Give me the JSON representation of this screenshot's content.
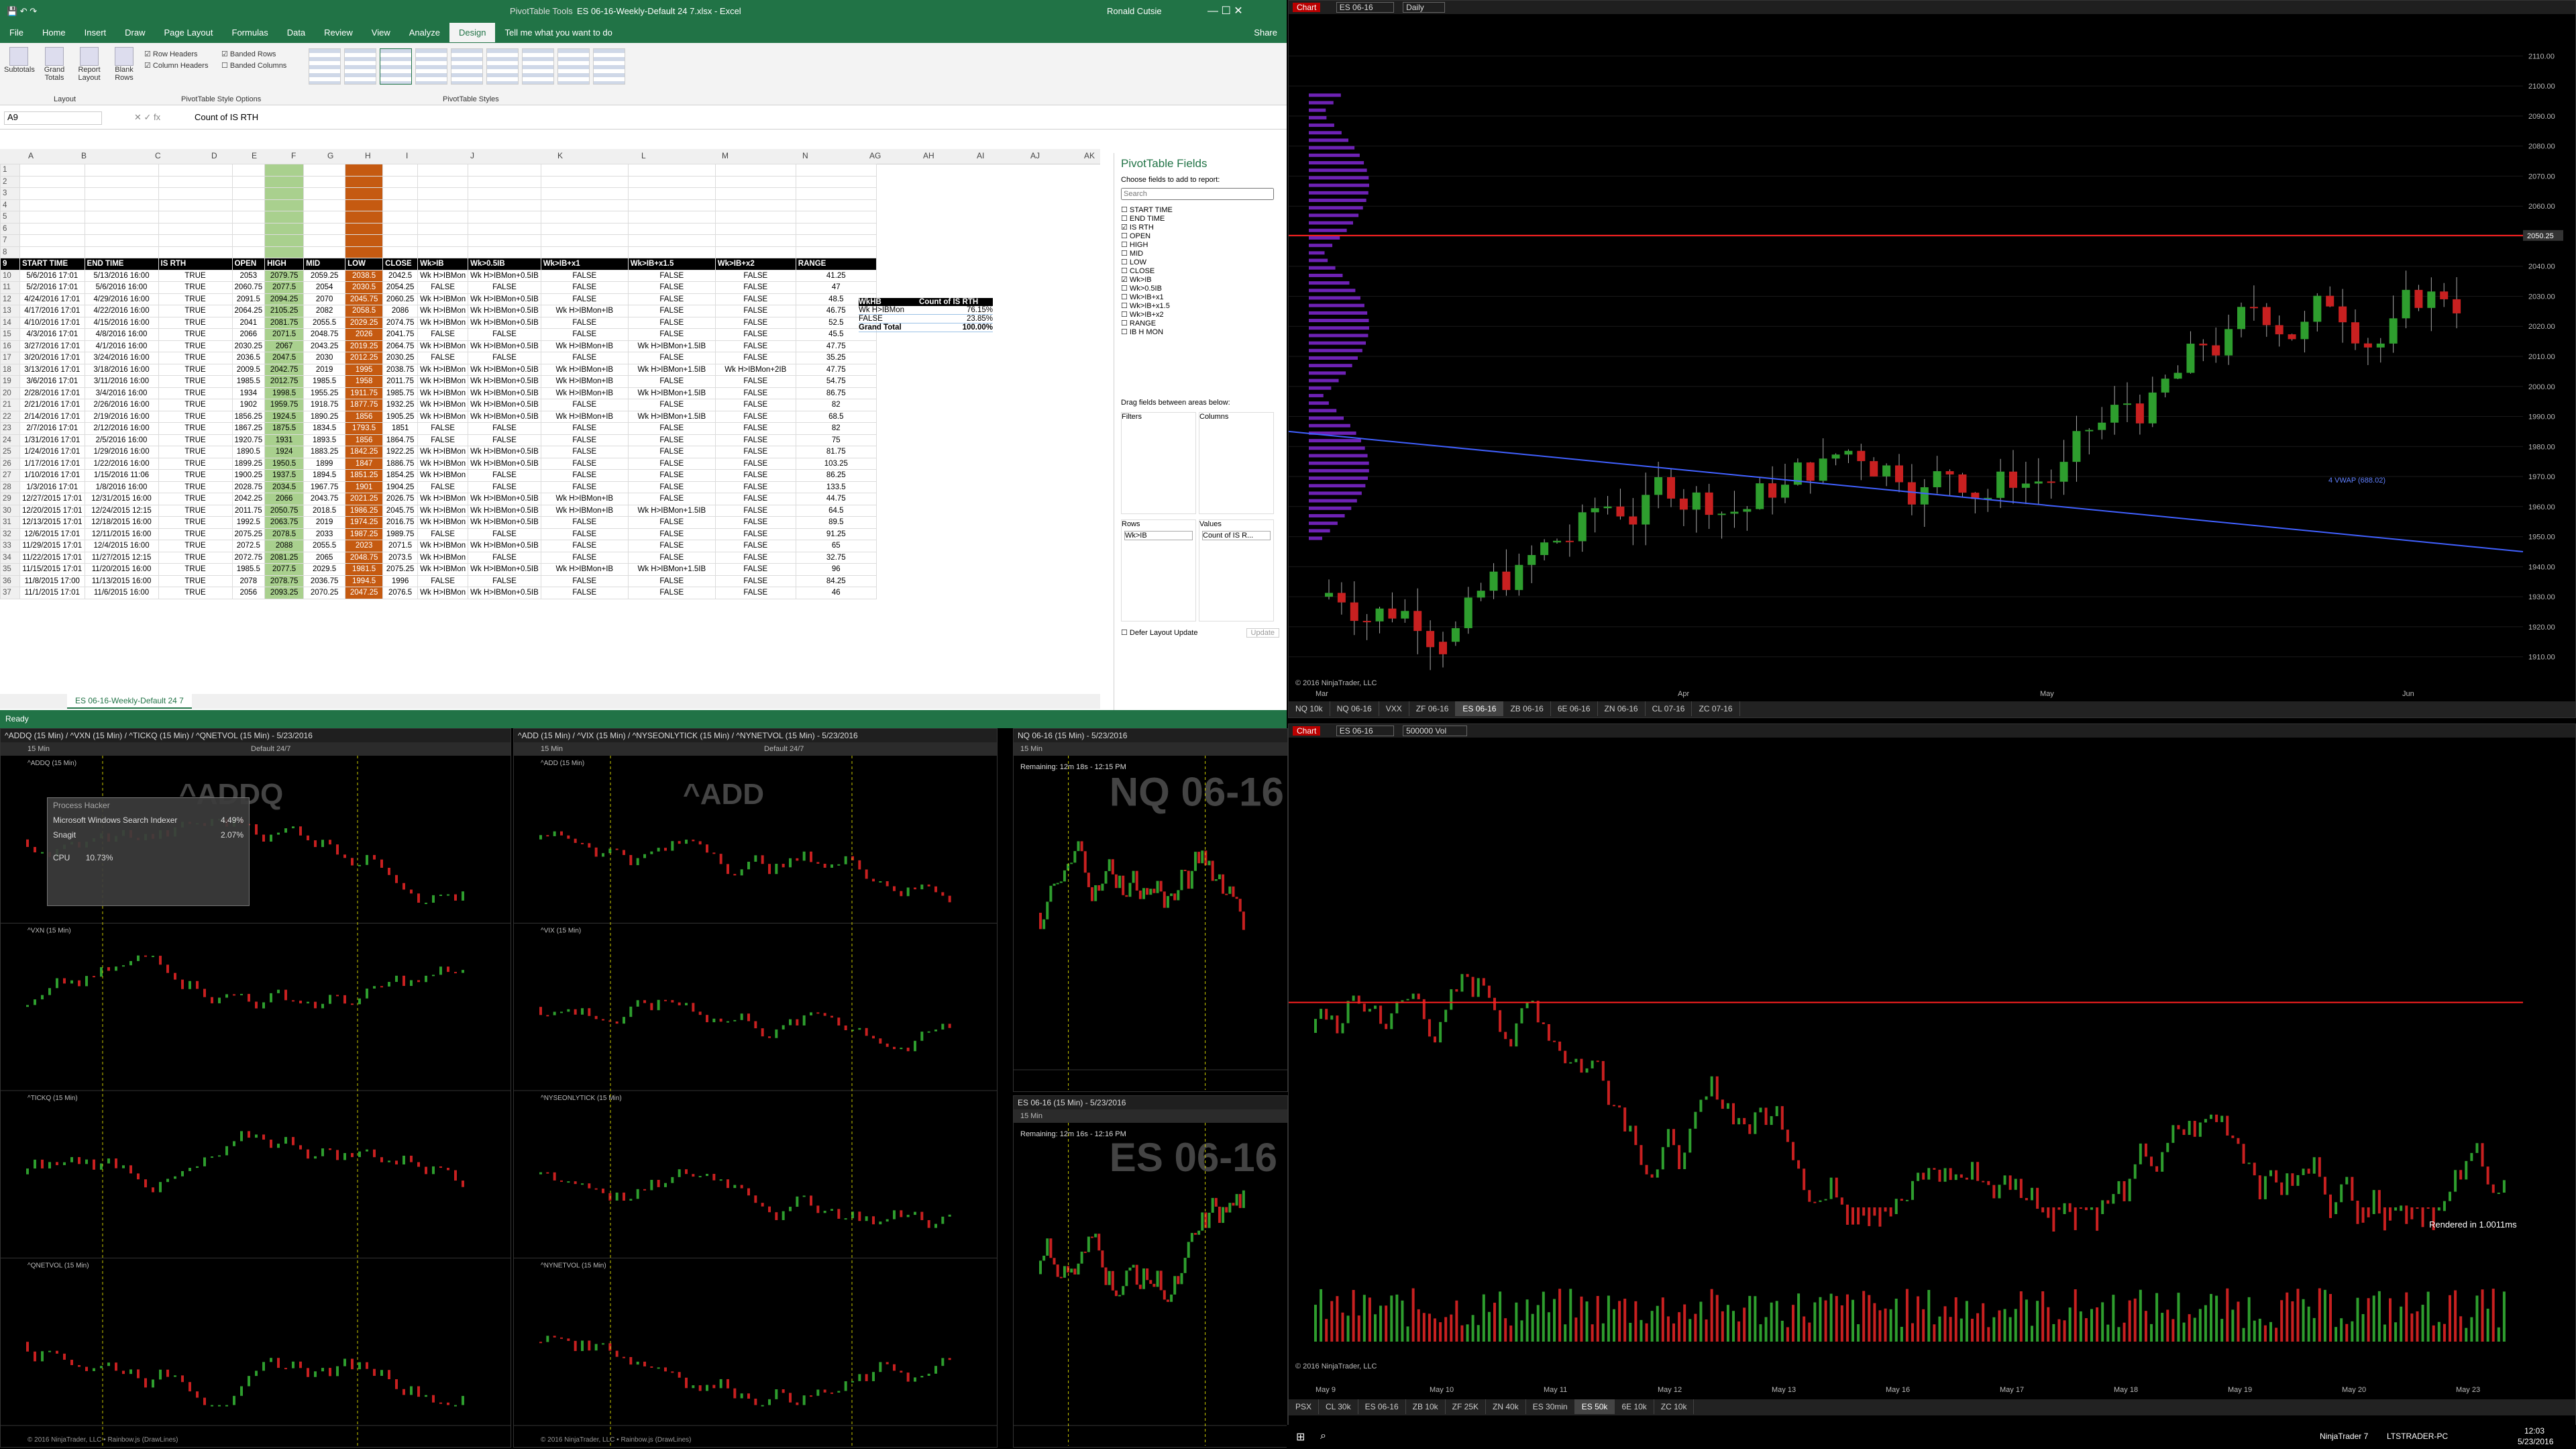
{
  "excel": {
    "title": "ES 06-16-Weekly-Default 24 7.xlsx - Excel",
    "context_tab": "PivotTable Tools",
    "user": "Ronald Cutsie",
    "tabs": [
      "File",
      "Home",
      "Insert",
      "Draw",
      "Page Layout",
      "Formulas",
      "Data",
      "Review",
      "View",
      "Analyze",
      "Design"
    ],
    "tell_me": "Tell me what you want to do",
    "share": "Share",
    "ribbon": {
      "layout": [
        "Subtotals",
        "Grand Totals",
        "Report Layout",
        "Blank Rows"
      ],
      "group_layout": "Layout",
      "options": [
        "Row Headers",
        "Banded Rows",
        "Column Headers",
        "Banded Columns"
      ],
      "group_options": "PivotTable Style Options",
      "group_styles": "PivotTable Styles"
    },
    "name_box": "A9",
    "formula": "Count of IS RTH",
    "columns": [
      "A",
      "B",
      "C",
      "D",
      "E",
      "F",
      "G",
      "H",
      "I",
      "J",
      "K",
      "L",
      "M",
      "N",
      "AG",
      "AH",
      "AI",
      "AJ",
      "AK"
    ],
    "header_row": [
      "START TIME",
      "END TIME",
      "IS RTH",
      "OPEN",
      "HIGH",
      "MID",
      "LOW",
      "CLOSE",
      "Wk>IB",
      "Wk>0.5IB",
      "Wk>IB+x1",
      "Wk>IB+x1.5",
      "Wk>IB+x2",
      "RANGE"
    ],
    "rows": [
      [
        "10",
        "5/6/2016 17:01",
        "5/13/2016 16:00",
        "TRUE",
        "2053",
        "2079.75",
        "2059.25",
        "2038.5",
        "2042.5",
        "Wk H>IBMon",
        "Wk H>IBMon+0.5IB",
        "FALSE",
        "FALSE",
        "FALSE",
        "41.25"
      ],
      [
        "11",
        "5/2/2016 17:01",
        "5/6/2016 16:00",
        "TRUE",
        "2060.75",
        "2077.5",
        "2054",
        "2030.5",
        "2054.25",
        "FALSE",
        "FALSE",
        "FALSE",
        "FALSE",
        "FALSE",
        "47"
      ],
      [
        "12",
        "4/24/2016 17:01",
        "4/29/2016 16:00",
        "TRUE",
        "2091.5",
        "2094.25",
        "2070",
        "2045.75",
        "2060.25",
        "Wk H>IBMon",
        "Wk H>IBMon+0.5IB",
        "FALSE",
        "FALSE",
        "FALSE",
        "48.5"
      ],
      [
        "13",
        "4/17/2016 17:01",
        "4/22/2016 16:00",
        "TRUE",
        "2064.25",
        "2105.25",
        "2082",
        "2058.5",
        "2086",
        "Wk H>IBMon",
        "Wk H>IBMon+0.5IB",
        "Wk H>IBMon+IB",
        "FALSE",
        "FALSE",
        "46.75"
      ],
      [
        "14",
        "4/10/2016 17:01",
        "4/15/2016 16:00",
        "TRUE",
        "2041",
        "2081.75",
        "2055.5",
        "2029.25",
        "2074.75",
        "Wk H>IBMon",
        "Wk H>IBMon+0.5IB",
        "FALSE",
        "FALSE",
        "FALSE",
        "52.5"
      ],
      [
        "15",
        "4/3/2016 17:01",
        "4/8/2016 16:00",
        "TRUE",
        "2066",
        "2071.5",
        "2048.75",
        "2026",
        "2041.75",
        "FALSE",
        "FALSE",
        "FALSE",
        "FALSE",
        "FALSE",
        "45.5"
      ],
      [
        "16",
        "3/27/2016 17:01",
        "4/1/2016 16:00",
        "TRUE",
        "2030.25",
        "2067",
        "2043.25",
        "2019.25",
        "2064.75",
        "Wk H>IBMon",
        "Wk H>IBMon+0.5IB",
        "Wk H>IBMon+IB",
        "Wk H>IBMon+1.5IB",
        "FALSE",
        "47.75"
      ],
      [
        "17",
        "3/20/2016 17:01",
        "3/24/2016 16:00",
        "TRUE",
        "2036.5",
        "2047.5",
        "2030",
        "2012.25",
        "2030.25",
        "FALSE",
        "FALSE",
        "FALSE",
        "FALSE",
        "FALSE",
        "35.25"
      ],
      [
        "18",
        "3/13/2016 17:01",
        "3/18/2016 16:00",
        "TRUE",
        "2009.5",
        "2042.75",
        "2019",
        "1995",
        "2038.75",
        "Wk H>IBMon",
        "Wk H>IBMon+0.5IB",
        "Wk H>IBMon+IB",
        "Wk H>IBMon+1.5IB",
        "Wk H>IBMon+2IB",
        "47.75"
      ],
      [
        "19",
        "3/6/2016 17:01",
        "3/11/2016 16:00",
        "TRUE",
        "1985.5",
        "2012.75",
        "1985.5",
        "1958",
        "2011.75",
        "Wk H>IBMon",
        "Wk H>IBMon+0.5IB",
        "Wk H>IBMon+IB",
        "FALSE",
        "FALSE",
        "54.75"
      ],
      [
        "20",
        "2/28/2016 17:01",
        "3/4/2016 16:00",
        "TRUE",
        "1934",
        "1998.5",
        "1955.25",
        "1911.75",
        "1985.75",
        "Wk H>IBMon",
        "Wk H>IBMon+0.5IB",
        "Wk H>IBMon+IB",
        "Wk H>IBMon+1.5IB",
        "FALSE",
        "86.75"
      ],
      [
        "21",
        "2/21/2016 17:01",
        "2/26/2016 16:00",
        "TRUE",
        "1902",
        "1959.75",
        "1918.75",
        "1877.75",
        "1932.25",
        "Wk H>IBMon",
        "Wk H>IBMon+0.5IB",
        "FALSE",
        "FALSE",
        "FALSE",
        "82"
      ],
      [
        "22",
        "2/14/2016 17:01",
        "2/19/2016 16:00",
        "TRUE",
        "1856.25",
        "1924.5",
        "1890.25",
        "1856",
        "1905.25",
        "Wk H>IBMon",
        "Wk H>IBMon+0.5IB",
        "Wk H>IBMon+IB",
        "Wk H>IBMon+1.5IB",
        "FALSE",
        "68.5"
      ],
      [
        "23",
        "2/7/2016 17:01",
        "2/12/2016 16:00",
        "TRUE",
        "1867.25",
        "1875.5",
        "1834.5",
        "1793.5",
        "1851",
        "FALSE",
        "FALSE",
        "FALSE",
        "FALSE",
        "FALSE",
        "82"
      ],
      [
        "24",
        "1/31/2016 17:01",
        "2/5/2016 16:00",
        "TRUE",
        "1920.75",
        "1931",
        "1893.5",
        "1856",
        "1864.75",
        "FALSE",
        "FALSE",
        "FALSE",
        "FALSE",
        "FALSE",
        "75"
      ],
      [
        "25",
        "1/24/2016 17:01",
        "1/29/2016 16:00",
        "TRUE",
        "1890.5",
        "1924",
        "1883.25",
        "1842.25",
        "1922.25",
        "Wk H>IBMon",
        "Wk H>IBMon+0.5IB",
        "FALSE",
        "FALSE",
        "FALSE",
        "81.75"
      ],
      [
        "26",
        "1/17/2016 17:01",
        "1/22/2016 16:00",
        "TRUE",
        "1899.25",
        "1950.5",
        "1899",
        "1847",
        "1886.75",
        "Wk H>IBMon",
        "Wk H>IBMon+0.5IB",
        "FALSE",
        "FALSE",
        "FALSE",
        "103.25"
      ],
      [
        "27",
        "1/10/2016 17:01",
        "1/15/2016 11:06",
        "TRUE",
        "1900.25",
        "1937.5",
        "1894.5",
        "1851.25",
        "1854.25",
        "Wk H>IBMon",
        "FALSE",
        "FALSE",
        "FALSE",
        "FALSE",
        "86.25"
      ],
      [
        "28",
        "1/3/2016 17:01",
        "1/8/2016 16:00",
        "TRUE",
        "2028.75",
        "2034.5",
        "1967.75",
        "1901",
        "1904.25",
        "FALSE",
        "FALSE",
        "FALSE",
        "FALSE",
        "FALSE",
        "133.5"
      ],
      [
        "29",
        "12/27/2015 17:01",
        "12/31/2015 16:00",
        "TRUE",
        "2042.25",
        "2066",
        "2043.75",
        "2021.25",
        "2026.75",
        "Wk H>IBMon",
        "Wk H>IBMon+0.5IB",
        "Wk H>IBMon+IB",
        "FALSE",
        "FALSE",
        "44.75"
      ],
      [
        "30",
        "12/20/2015 17:01",
        "12/24/2015 12:15",
        "TRUE",
        "2011.75",
        "2050.75",
        "2018.5",
        "1986.25",
        "2045.75",
        "Wk H>IBMon",
        "Wk H>IBMon+0.5IB",
        "Wk H>IBMon+IB",
        "Wk H>IBMon+1.5IB",
        "FALSE",
        "64.5"
      ],
      [
        "31",
        "12/13/2015 17:01",
        "12/18/2015 16:00",
        "TRUE",
        "1992.5",
        "2063.75",
        "2019",
        "1974.25",
        "2016.75",
        "Wk H>IBMon",
        "Wk H>IBMon+0.5IB",
        "FALSE",
        "FALSE",
        "FALSE",
        "89.5"
      ],
      [
        "32",
        "12/6/2015 17:01",
        "12/11/2015 16:00",
        "TRUE",
        "2075.25",
        "2078.5",
        "2033",
        "1987.25",
        "1989.75",
        "FALSE",
        "FALSE",
        "FALSE",
        "FALSE",
        "FALSE",
        "91.25"
      ],
      [
        "33",
        "11/29/2015 17:01",
        "12/4/2015 16:00",
        "TRUE",
        "2072.5",
        "2088",
        "2055.5",
        "2023",
        "2071.5",
        "Wk H>IBMon",
        "Wk H>IBMon+0.5IB",
        "FALSE",
        "FALSE",
        "FALSE",
        "65"
      ],
      [
        "34",
        "11/22/2015 17:01",
        "11/27/2015 12:15",
        "TRUE",
        "2072.75",
        "2081.25",
        "2065",
        "2048.75",
        "2073.5",
        "Wk H>IBMon",
        "FALSE",
        "FALSE",
        "FALSE",
        "FALSE",
        "32.75"
      ],
      [
        "35",
        "11/15/2015 17:01",
        "11/20/2015 16:00",
        "TRUE",
        "1985.5",
        "2077.5",
        "2029.5",
        "1981.5",
        "2075.25",
        "Wk H>IBMon",
        "Wk H>IBMon+0.5IB",
        "Wk H>IBMon+IB",
        "Wk H>IBMon+1.5IB",
        "FALSE",
        "96"
      ],
      [
        "36",
        "11/8/2015 17:00",
        "11/13/2015 16:00",
        "TRUE",
        "2078",
        "2078.75",
        "2036.75",
        "1994.5",
        "1996",
        "FALSE",
        "FALSE",
        "FALSE",
        "FALSE",
        "FALSE",
        "84.25"
      ],
      [
        "37",
        "11/1/2015 17:01",
        "11/6/2015 16:00",
        "TRUE",
        "2056",
        "2093.25",
        "2070.25",
        "2047.25",
        "2076.5",
        "Wk H>IBMon",
        "Wk H>IBMon+0.5IB",
        "FALSE",
        "FALSE",
        "FALSE",
        "46"
      ]
    ],
    "pivot_table": {
      "headers": [
        "WkHB",
        "Count of IS RTH"
      ],
      "rows": [
        [
          "Wk H>IBMon",
          "76.15%"
        ],
        [
          "FALSE",
          "23.85%"
        ],
        [
          "Grand Total",
          "100.00%"
        ]
      ]
    },
    "pivot_fields": {
      "title": "PivotTable Fields",
      "choose": "Choose fields to add to report:",
      "search_placeholder": "Search",
      "fields": [
        "START TIME",
        "END TIME",
        "IS RTH",
        "OPEN",
        "HIGH",
        "MID",
        "LOW",
        "CLOSE",
        "Wk>IB",
        "Wk>0.5IB",
        "Wk>IB+x1",
        "Wk>IB+x1.5",
        "Wk>IB+x2",
        "RANGE",
        "IB H MON"
      ],
      "checked": [
        "IS RTH",
        "Wk>IB"
      ],
      "drag": "Drag fields between areas below:",
      "filters": "Filters",
      "columns": "Columns",
      "rows": "Rows",
      "values": "Values",
      "rows_value": "Wk>IB",
      "values_value": "Count of IS R...",
      "defer": "Defer Layout Update",
      "update": "Update"
    },
    "sheet_tab": "ES 06-16-Weekly-Default 24 7",
    "status": "Ready"
  },
  "chart_top": {
    "label": "Chart",
    "instrument": "ES 06-16",
    "period": "Daily",
    "prices": [
      "2110.00",
      "2100.00",
      "2090.00",
      "2080.00",
      "2070.00",
      "2060.00",
      "2050.00",
      "2040.00",
      "2030.00",
      "2020.00",
      "2010.00",
      "2000.00",
      "1990.00",
      "1980.00",
      "1970.00",
      "1960.00",
      "1950.00",
      "1940.00",
      "1930.00",
      "1920.00",
      "1910.00"
    ],
    "current_price": "2050.25",
    "dates": [
      "Mar",
      "Apr",
      "May",
      "Jun"
    ],
    "vwap_label": "4 VWAP (688.02)",
    "copyright": "© 2016 NinjaTrader, LLC",
    "tabs": [
      "NQ 10k",
      "NQ 06-16",
      "VXX",
      "ZF 06-16",
      "ES 06-16",
      "ZB 06-16",
      "6E 06-16",
      "ZN 06-16",
      "CL 07-16",
      "ZC 07-16"
    ],
    "selected_tab": "ES 06-16"
  },
  "chart_bottom": {
    "label": "Chart",
    "instrument": "ES 06-16",
    "period": "500000 Vol",
    "rendered": "Rendered in 1.0011ms",
    "current_price": "2050.25",
    "copyright": "© 2016 NinjaTrader, LLC",
    "tabs": [
      "PSX",
      "CL 30k",
      "ES 06-16",
      "ZB 10k",
      "ZF 25K",
      "ZN 40k",
      "ES 30min",
      "ES 50k",
      "6E 10k",
      "ZC 10k"
    ],
    "selected_tab": "ES 50k",
    "dates": [
      "May 9",
      "May 10",
      "May 11",
      "May 12",
      "May 13",
      "May 16",
      "May 17",
      "May 18",
      "May 19",
      "May 20",
      "May 23"
    ]
  },
  "small_charts": [
    {
      "title": "^ADDQ (15 Min) / ^VXN (15 Min) / ^TICKQ (15 Min) / ^QNETVOL (15 Min) - 5/23/2016",
      "watermark": "^ADDQ",
      "period": "15 Min",
      "default": "Default 24/7",
      "panels": [
        "^ADDQ (15 Min)",
        "^VXN (15 Min)",
        "^TICKQ (15 Min)",
        "^QNETVOL (15 Min)"
      ],
      "copyright": "© 2016 NinjaTrader, LLC • Rainbow.js (DrawLines)"
    },
    {
      "title": "^ADD (15 Min) / ^VIX (15 Min) / ^NYSEONLYTICK (15 Min) / ^NYNETVOL (15 Min) - 5/23/2016",
      "watermark": "^ADD",
      "period": "15 Min",
      "default": "Default 24/7",
      "panels": [
        "^ADD (15 Min)",
        "^VIX (15 Min)",
        "^NYSEONLYTICK (15 Min)",
        "^NYNETVOL (15 Min)"
      ],
      "copyright": "© 2016 NinjaTrader, LLC • Rainbow.js (DrawLines)"
    },
    {
      "title": "NQ 06-16 (15 Min) - 5/23/2016",
      "watermark": "NQ 06-16",
      "period": "15 Min",
      "remaining": "Remaining: 12m 18s - 12:15 PM"
    },
    {
      "title": "ES 06-16 (15 Min) - 5/23/2016",
      "watermark": "ES 06-16",
      "period": "15 Min",
      "remaining": "Remaining: 12m 16s - 12:16 PM"
    }
  ],
  "popup": {
    "title": "Process Hacker",
    "items": [
      [
        "Microsoft Windows Search Indexer",
        "4.49%"
      ],
      [
        "Snagit",
        "2.07%"
      ]
    ],
    "cpu_label": "CPU",
    "cpu_value": "10.73%"
  },
  "taskbar": {
    "app": "NinjaTrader 7",
    "host": "LTSTRADER-PC",
    "time": "12:03",
    "date": "5/23/2016"
  },
  "colors": {
    "excel_green": "#217346",
    "green_col": "#a9d08e",
    "orange_col": "#c55a11",
    "up_candle": "#2e9e2e",
    "down_candle": "#c82020",
    "vwap": "#4060ff",
    "poc": "#ff2020",
    "profile": "#8a2be2"
  }
}
